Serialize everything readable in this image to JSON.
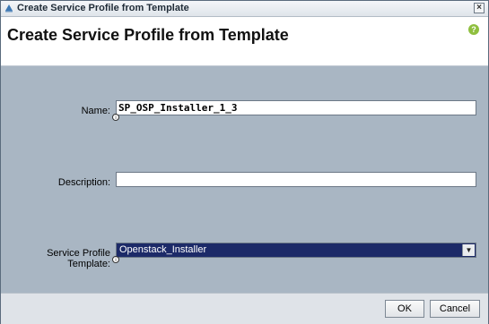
{
  "window": {
    "title": "Create Service Profile from Template",
    "close_glyph": "×",
    "app_icon": "ucs-app-icon"
  },
  "header": {
    "title": "Create Service Profile from Template",
    "help_icon": "help-icon",
    "help_glyph": "?"
  },
  "form": {
    "name_label": "Name:",
    "name_value": "SP_OSP_Installer_1_3",
    "description_label": "Description:",
    "description_value": "",
    "template_label": "Service Profile Template:",
    "template_selected": "Openstack_Installer",
    "info_glyph": "i"
  },
  "footer": {
    "ok_label": "OK",
    "cancel_label": "Cancel"
  },
  "colors": {
    "background": "#a9b6c3",
    "select_highlight": "#1c2a68",
    "help_green": "#8fbf3f"
  }
}
